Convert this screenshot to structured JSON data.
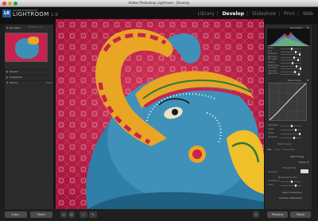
{
  "window": {
    "title": "Adobe Photoshop Lightroom - Develop"
  },
  "identity": {
    "badge": "LR",
    "sub": "ADOBE PHOTOSHOP",
    "name": "LIGHTROOM",
    "version": "1.0"
  },
  "modules": [
    {
      "label": "Library",
      "active": false
    },
    {
      "label": "Develop",
      "active": true
    },
    {
      "label": "Slideshow",
      "active": false
    },
    {
      "label": "Print",
      "active": false
    },
    {
      "label": "Web",
      "active": false
    }
  ],
  "left_panel": {
    "navigator": {
      "title": "Navigator",
      "zoom_options": "FIT  FILL  1:1  3:1"
    },
    "sections": [
      {
        "label": "Presets",
        "extra": ""
      },
      {
        "label": "Snapshots",
        "extra": ""
      },
      {
        "label": "History",
        "extra": "Clear"
      }
    ]
  },
  "right_panel": {
    "histogram_title": "Histogram",
    "basic_sliders": [
      "Temp",
      "Tint",
      "Exposure",
      "Recovery",
      "Fill Light",
      "Blacks",
      "Brightness",
      "Contrast",
      "Vibrance",
      "Saturation"
    ],
    "tone_curve_title": "Tone Curve",
    "tone_sliders": [
      "Highlights",
      "Lights",
      "Darks",
      "Shadows"
    ],
    "point_curve_label": "Point Curve",
    "hsl_tabs": [
      "HSL",
      "Color",
      "Grayscale"
    ],
    "split_toning": "Split Toning",
    "detail": "Detail",
    "sharpening": "Sharpening",
    "amount_label": "Amount",
    "noise_reduction": "Noise Reduction",
    "nr_sliders": [
      "Luminance",
      "Color"
    ],
    "lens_corrections": "Lens Corrections",
    "camera_calibration": "Camera Calibration"
  },
  "bottom": {
    "copy_label": "Copy...",
    "paste_label": "Paste",
    "previous_label": "Previous",
    "reset_label": "Reset"
  },
  "colors": {
    "accent_blue": "#2a5aa0",
    "panel_bg": "#2b2b2b",
    "photo_magenta": "#c8234e",
    "elephant_blue": "#3e8fb5",
    "trunk_orange": "#e9a524"
  }
}
